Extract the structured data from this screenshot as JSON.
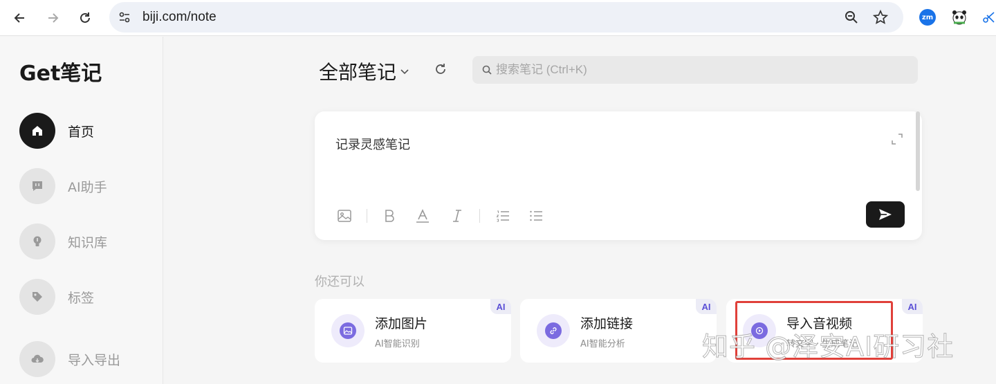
{
  "browser": {
    "url": "biji.com/note",
    "extensions": [
      {
        "name": "zm-extension-icon",
        "label": "zm",
        "color": "#1a73e8"
      },
      {
        "name": "panda-extension-icon",
        "label": "",
        "color": "#ffffff"
      }
    ]
  },
  "sidebar": {
    "logo": "Get笔记",
    "items": [
      {
        "label": "首页",
        "icon": "home-icon",
        "active": true
      },
      {
        "label": "AI助手",
        "icon": "chat-icon",
        "active": false
      },
      {
        "label": "知识库",
        "icon": "bulb-icon",
        "active": false
      },
      {
        "label": "标签",
        "icon": "tag-icon",
        "active": false
      },
      {
        "label": "导入导出",
        "icon": "cloud-icon",
        "active": false
      }
    ]
  },
  "main": {
    "title": "全部笔记",
    "search_placeholder": "搜索笔记 (Ctrl+K)",
    "editor": {
      "placeholder": "记录灵感笔记",
      "tools": [
        "image-icon",
        "bold-icon",
        "text-color-icon",
        "italic-icon",
        "ordered-list-icon",
        "bullet-list-icon"
      ]
    },
    "section_label": "你还可以",
    "cards": [
      {
        "title": "添加图片",
        "subtitle": "AI智能识别",
        "badge": "AI",
        "icon": "image-icon"
      },
      {
        "title": "添加链接",
        "subtitle": "AI智能分析",
        "badge": "AI",
        "icon": "link-icon"
      },
      {
        "title": "导入音视频",
        "subtitle": "转文字 · 生成笔记",
        "badge": "AI",
        "icon": "audio-icon"
      }
    ]
  },
  "overlay": {
    "watermark": "知乎 @泽安AI研习社",
    "highlight_color": "#e0403a"
  },
  "colors": {
    "accent": "#7b6be0",
    "dark": "#1a1a1a"
  }
}
